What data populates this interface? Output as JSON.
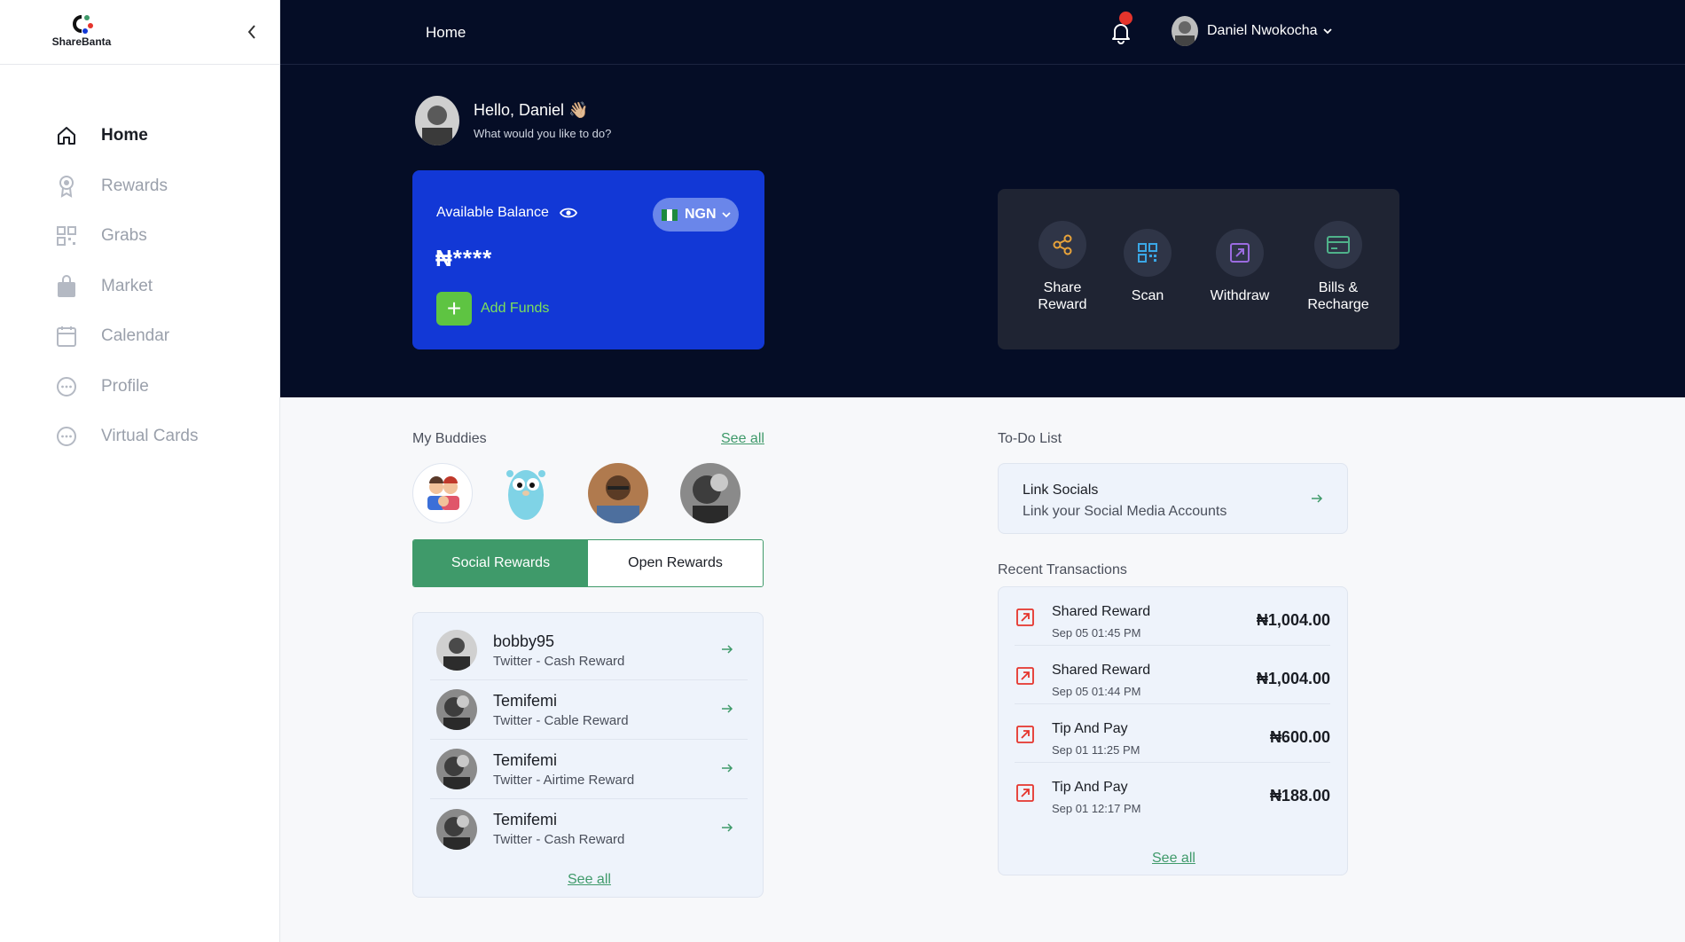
{
  "app": {
    "brand": "ShareBanta"
  },
  "sidebar": {
    "items": [
      {
        "label": "Home",
        "icon": "home-icon"
      },
      {
        "label": "Rewards",
        "icon": "award-icon"
      },
      {
        "label": "Grabs",
        "icon": "grid-icon"
      },
      {
        "label": "Market",
        "icon": "bag-icon"
      },
      {
        "label": "Calendar",
        "icon": "calendar-icon"
      },
      {
        "label": "Profile",
        "icon": "dots-circle-icon"
      },
      {
        "label": "Virtual Cards",
        "icon": "dots-circle-icon"
      }
    ]
  },
  "header": {
    "breadcrumb": "Home",
    "user_name": "Daniel Nwokocha"
  },
  "greeting": {
    "title": "Hello, Daniel 👋🏼",
    "subtitle": "What would you like to do?"
  },
  "balance": {
    "label": "Available Balance",
    "currency": "NGN",
    "value": "₦****",
    "add_funds": "Add Funds"
  },
  "actions": [
    {
      "label": "Share Reward",
      "icon": "share-icon"
    },
    {
      "label": "Scan",
      "icon": "qr-icon"
    },
    {
      "label": "Withdraw",
      "icon": "withdraw-icon"
    },
    {
      "label": "Bills & Recharge",
      "icon": "card-icon"
    }
  ],
  "buddies": {
    "title": "My Buddies",
    "see_all": "See all"
  },
  "reward_tabs": [
    "Social Rewards",
    "Open Rewards"
  ],
  "rewards": {
    "items": [
      {
        "name": "bobby95",
        "desc": "Twitter - Cash Reward"
      },
      {
        "name": "Temifemi",
        "desc": "Twitter - Cable Reward"
      },
      {
        "name": "Temifemi",
        "desc": "Twitter - Airtime Reward"
      },
      {
        "name": "Temifemi",
        "desc": "Twitter - Cash Reward"
      }
    ],
    "see_all": "See all"
  },
  "todo": {
    "title": "To-Do List",
    "item_title": "Link Socials",
    "item_desc": "Link your Social Media Accounts"
  },
  "transactions": {
    "title": "Recent Transactions",
    "items": [
      {
        "name": "Shared Reward",
        "date": "Sep 05 01:45 PM",
        "amount": "₦1,004.00"
      },
      {
        "name": "Shared Reward",
        "date": "Sep 05 01:44 PM",
        "amount": "₦1,004.00"
      },
      {
        "name": "Tip And Pay",
        "date": "Sep 01 11:25 PM",
        "amount": "₦600.00"
      },
      {
        "name": "Tip And Pay",
        "date": "Sep 01 12:17 PM",
        "amount": "₦188.00"
      }
    ],
    "see_all": "See all"
  },
  "colors": {
    "primary_blue": "#1238d6",
    "accent_green": "#3f9a6a",
    "dark_bg": "#050d26",
    "alert_red": "#e5342c"
  }
}
